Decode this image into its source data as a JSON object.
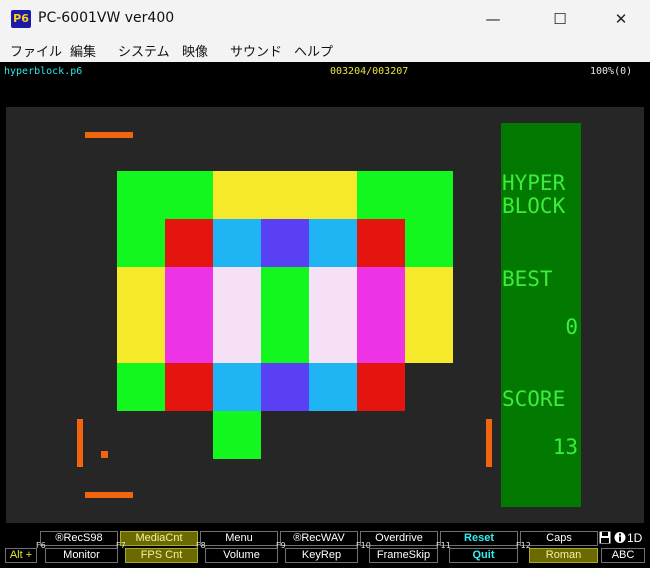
{
  "window": {
    "icon_text": "P6",
    "title": "PC-6001VW ver400",
    "minimize": "—",
    "maximize": "☐",
    "close": "✕"
  },
  "menu": [
    "ファイル",
    "編集",
    "システム",
    "映像",
    "サウンド",
    "ヘルプ"
  ],
  "status": {
    "file": "hyperblock.p6",
    "counter": "003204/003207",
    "speed": "100%(0)"
  },
  "game": {
    "colors": {
      "bg": "#262626",
      "green": "#12f81f",
      "yellow": "#f5e929",
      "red": "#e4140f",
      "cyan": "#1fb5f5",
      "blue": "#5a40f5",
      "magenta": "#ee32e6",
      "white": "#f5e0f5",
      "paddle": "#f2650f",
      "panel": "#027a02",
      "panel_text": "#3dec3d"
    },
    "grid": [
      [
        "green",
        "green",
        "yellow",
        "yellow",
        "yellow",
        "green",
        "green"
      ],
      [
        "green",
        "red",
        "cyan",
        "blue",
        "cyan",
        "red",
        "green"
      ],
      [
        "yellow",
        "magenta",
        "white",
        "green",
        "white",
        "magenta",
        "yellow"
      ],
      [
        "yellow",
        "magenta",
        "white",
        "green",
        "white",
        "magenta",
        "yellow"
      ],
      [
        "green",
        "red",
        "cyan",
        "blue",
        "cyan",
        "red",
        ""
      ],
      [
        "",
        "",
        "green",
        "",
        "",
        "",
        ""
      ]
    ],
    "panel": {
      "title_line1": "HYPER",
      "title_line2": "BLOCK",
      "best_label": "BEST",
      "best_value": "0",
      "score_label": "SCORE",
      "score_value": "13"
    }
  },
  "keybar": {
    "top": [
      "®RecS98",
      "MediaCnt",
      "Menu",
      "®RecWAV",
      "Overdrive",
      "Reset",
      "Caps"
    ],
    "bottom": [
      "Monitor",
      "FPS Cnt",
      "Volume",
      "KeyRep",
      "FrameSkip",
      "Quit",
      "Roman"
    ],
    "fkeys": [
      "F6",
      "F7",
      "F8",
      "F9",
      "F10",
      "F11",
      "F12"
    ],
    "alt_label": "Alt +",
    "indicator_icons": [
      "floppy-icon",
      "info-icon"
    ],
    "indicator_text": "1D",
    "abc_label": "ABC"
  }
}
